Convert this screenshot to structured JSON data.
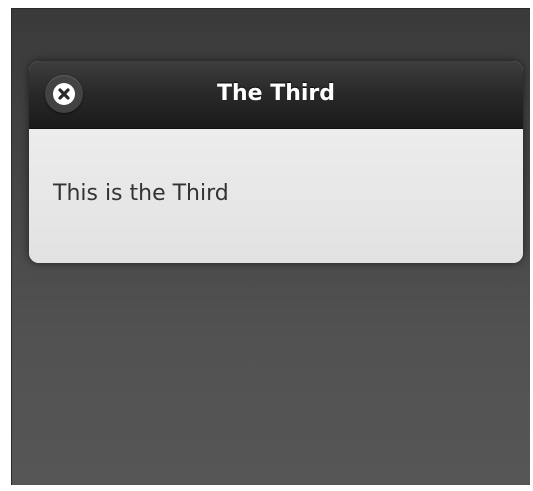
{
  "dialog": {
    "title": "The Third",
    "body_text": "This is the Third",
    "close_icon": "close-icon"
  },
  "colors": {
    "header_bg": "#1e1e1e",
    "content_bg": "#e6e6e6",
    "screen_bg": "#4a4a4a",
    "title_text": "#ffffff",
    "body_text": "#333333"
  }
}
